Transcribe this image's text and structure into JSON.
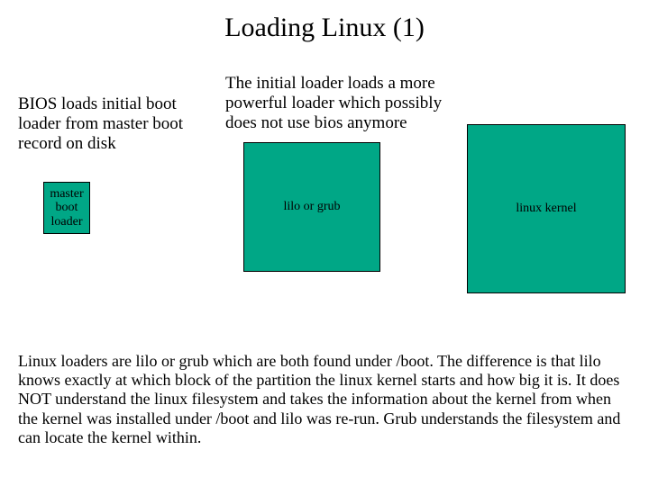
{
  "title": "Loading Linux (1)",
  "desc_left": "BIOS loads initial boot loader from master boot record on disk",
  "desc_mid": "The initial loader loads a more powerful loader which possibly does not use bios anymore",
  "boxes": {
    "small": "master boot loader",
    "mid": "lilo or grub",
    "large": "linux kernel"
  },
  "footer": "Linux loaders are lilo or grub which are both found under /boot. The difference is that lilo knows exactly at which block of the partition the linux kernel starts and how big it is. It does NOT understand the linux filesystem and takes the information about the kernel from when the kernel was installed under /boot and lilo was re-run. Grub understands the filesystem and can locate the kernel within.",
  "colors": {
    "box_fill": "#00a786"
  }
}
